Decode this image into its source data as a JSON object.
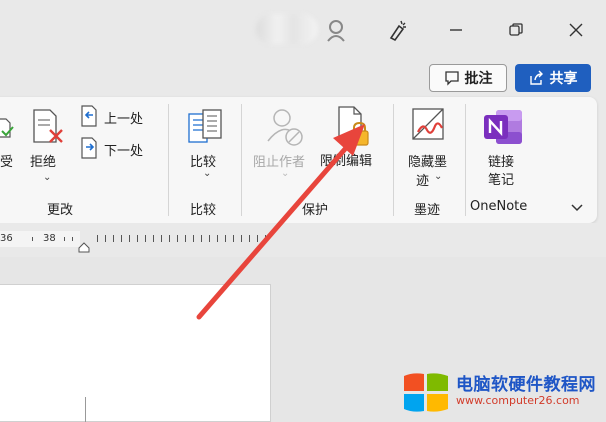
{
  "header": {
    "comment_label": "批注",
    "share_label": "共享"
  },
  "ribbon": {
    "changes": {
      "reject_label": "拒绝",
      "previous_label": "上一处",
      "next_label": "下一处",
      "group_label": "更改"
    },
    "compare": {
      "compare_label": "比较",
      "group_label": "比较"
    },
    "protect": {
      "block_authors_label": "阻止作者",
      "restrict_editing_label": "限制编辑",
      "group_label": "保护"
    },
    "ink": {
      "hide_ink_line1": "隐藏墨",
      "hide_ink_line2": "迹",
      "group_label": "墨迹"
    },
    "onenote": {
      "linked_notes_line1": "链接",
      "linked_notes_line2": "笔记",
      "group_label": "OneNote"
    }
  },
  "ruler": {
    "marks": [
      "36",
      "38"
    ]
  },
  "watermark": {
    "title": "电脑软硬件教程网",
    "url": "www.computer26.com"
  },
  "colors": {
    "share_button": "#1f5fbf",
    "arrow": "#e8453c",
    "onenote": "#7b2fbe"
  }
}
